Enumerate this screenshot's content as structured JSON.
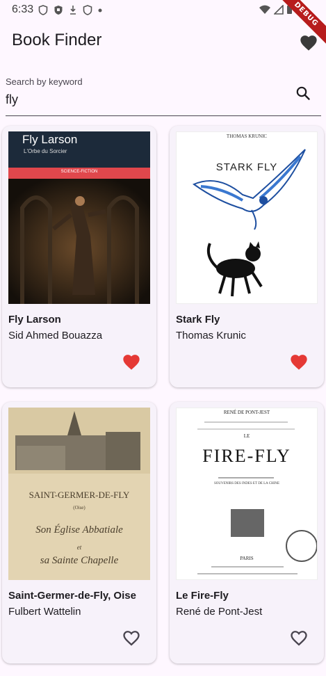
{
  "status_bar": {
    "time": "6:33",
    "debug_label": "DEBUG"
  },
  "app": {
    "title": "Book Finder"
  },
  "search": {
    "label": "Search by keyword",
    "value": "fly"
  },
  "books": [
    {
      "title": "Fly Larson",
      "author": "Sid Ahmed Bouazza",
      "favorite": true,
      "cover": {
        "header_title": "Fly Larson",
        "header_subtitle": "L'Orbe du Sorcier",
        "band_text": "SCIENCE-FICTION"
      }
    },
    {
      "title": "Stark Fly",
      "author": "Thomas Krunic",
      "favorite": true,
      "cover": {
        "top_text": "THOMAS KRUNIC",
        "title_text": "STARK FLY"
      }
    },
    {
      "title": "Saint-Germer-de-Fly, Oise",
      "author": "Fulbert Wattelin",
      "favorite": false,
      "cover": {
        "title_text": "SAINT-GERMER-DE-FLY",
        "sub_text": "(Oise)",
        "script_line1": "Son Église Abbatiale",
        "script_line2": "et",
        "script_line3": "sa Sainte Chapelle"
      }
    },
    {
      "title": "Le Fire-Fly",
      "author": "René de Pont-Jest",
      "favorite": false,
      "cover": {
        "top_text": "RENÉ DE PONT-JEST",
        "le_text": "LE",
        "title_text": "FIRE-FLY",
        "sub_text": "SOUVENIRS DES INDES ET DE LA CHINE",
        "city_text": "PARIS"
      }
    }
  ],
  "colors": {
    "heart_filled": "#e53935",
    "heart_outline": "#49454f",
    "background": "#fef7ff",
    "card": "#f7f2fa"
  }
}
